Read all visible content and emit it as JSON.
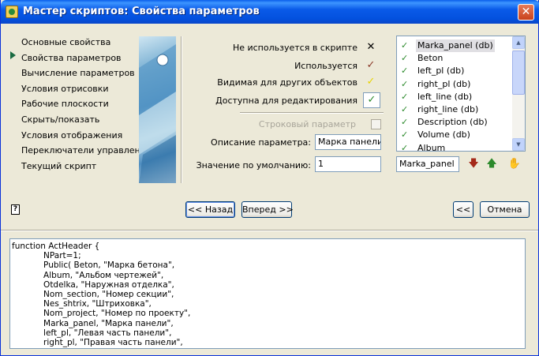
{
  "window": {
    "title": "Мастер скриптов:  Свойства параметров",
    "close": "✕"
  },
  "nav": {
    "items": [
      "Основные свойства",
      "Свойства параметров",
      "Вычисление параметров",
      "Условия отрисовки",
      "Рабочие плоскости",
      "Скрыть/показать",
      "Условия отображения",
      "Переключатели управления",
      "Текущий скрипт"
    ],
    "selected_index": 1
  },
  "status_legend": {
    "not_used": "Не используется в скрипте",
    "used": "Используется",
    "visible": "Видимая для других объектов",
    "editable": "Доступна для редактирования"
  },
  "status_icons": {
    "not_used": "✕",
    "used": "✓",
    "visible": "✓",
    "editable": "✓",
    "not_used_color": "#A8A8A8",
    "used_color": "#8B3A2A",
    "visible_color": "#E8D400",
    "editable_color": "#2C8A2C"
  },
  "string_param": {
    "label": "Строковый параметр",
    "checked": false
  },
  "description": {
    "label": "Описание параметра:",
    "value": "Марка панели"
  },
  "default_value": {
    "label": "Значение по умолчанию:",
    "value": "1"
  },
  "param_list": {
    "items": [
      "Marka_panel (db)",
      "Beton",
      "left_pl (db)",
      "right_pl (db)",
      "left_line (db)",
      "right_line (db)",
      "Description (db)",
      "Volume (db)",
      "Album"
    ],
    "selected_index": 0,
    "check_icon": "✓"
  },
  "selected_param": {
    "value": "Marka_panel"
  },
  "list_actions": {
    "down_arrow": "🡇",
    "up_arrow": "🡅",
    "hand_icon": "✋"
  },
  "buttons": {
    "back": "<< Назад",
    "next": "Вперед >>",
    "back_short": "<<",
    "cancel": "Отмена",
    "help": "?"
  },
  "code": {
    "lines": [
      "function ActHeader {",
      "            NPart=1;",
      "            Public( Beton, \"Марка бетона\",",
      "            Album, \"Альбом чертежей\",",
      "            Otdelka, \"Наружная отделка\",",
      "            Nom_section, \"Номер секции\",",
      "            Nes_shtrix, \"Штриховка\",",
      "            Nom_project, \"Номер по проекту\",",
      "            Marka_panel, \"Марка панели\",",
      "            left_pl, \"Левая часть панели\",",
      "            right_pl, \"Правая часть панели\","
    ]
  },
  "colors": {
    "titlebar": "#0A5AE8",
    "dialog_bg": "#ECE9D8",
    "accent_green": "#1A6B42"
  }
}
